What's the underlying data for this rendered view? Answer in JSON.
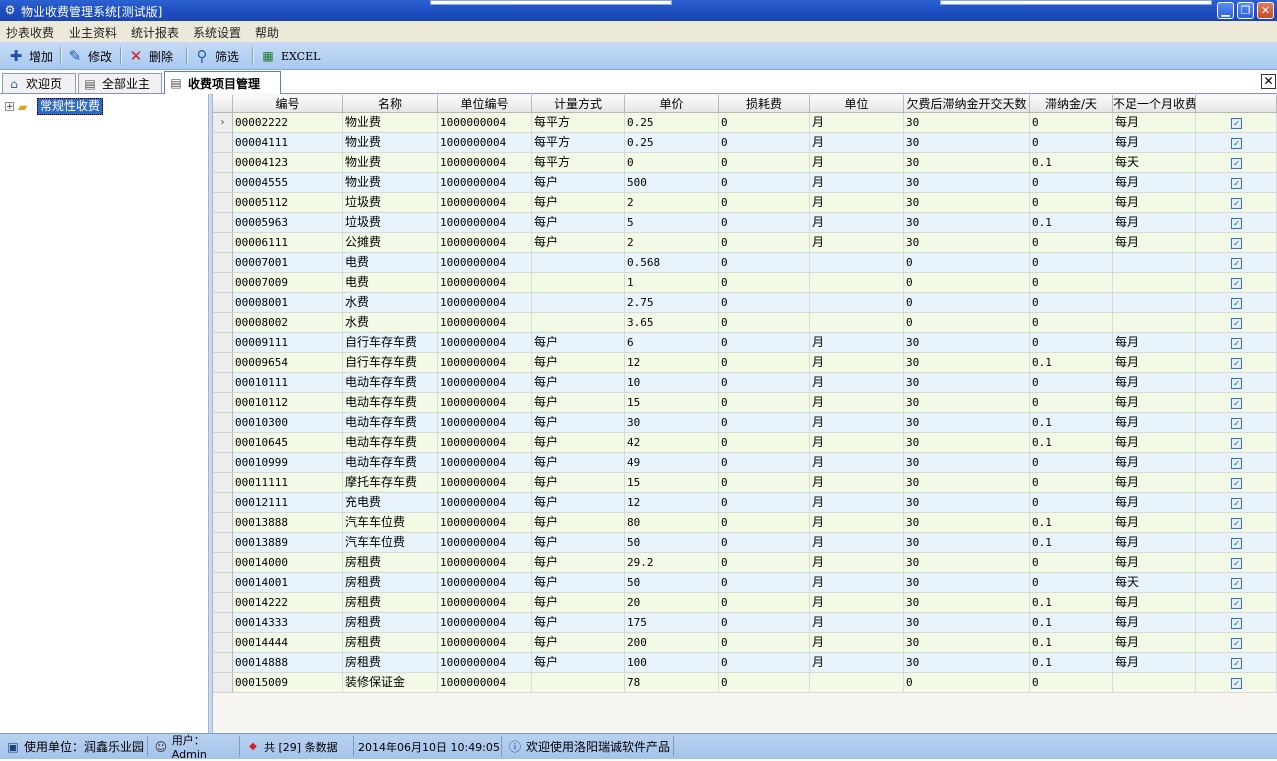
{
  "window": {
    "title": "物业收费管理系统[测试版]",
    "minimize": "▁",
    "restore": "❐",
    "close": "✕"
  },
  "menu": [
    "抄表收费",
    "业主资料",
    "统计报表",
    "系统设置",
    "帮助"
  ],
  "toolbar": {
    "add": "增加",
    "edit": "修改",
    "delete": "删除",
    "filter": "筛选",
    "excel": "EXCEL"
  },
  "tabs": [
    "欢迎页",
    "全部业主",
    "收费项目管理"
  ],
  "tab_close": "✕",
  "tree": {
    "expander": "+",
    "root": "常规性收费"
  },
  "grid": {
    "columns": [
      "编号",
      "名称",
      "单位编号",
      "计量方式",
      "单价",
      "损耗费",
      "单位",
      "欠费后滞纳金开交天数",
      "滞纳金/天",
      "不足一个月收费",
      ""
    ],
    "current_row_marker": "›",
    "check_mark": "✓",
    "rows": [
      [
        "00002222",
        "物业费",
        "1000000004",
        "每平方",
        "0.25",
        "0",
        "月",
        "30",
        "0",
        "每月"
      ],
      [
        "00004111",
        "物业费",
        "1000000004",
        "每平方",
        "0.25",
        "0",
        "月",
        "30",
        "0",
        "每月"
      ],
      [
        "00004123",
        "物业费",
        "1000000004",
        "每平方",
        "0",
        "0",
        "月",
        "30",
        "0.1",
        "每天"
      ],
      [
        "00004555",
        "物业费",
        "1000000004",
        "每户",
        "500",
        "0",
        "月",
        "30",
        "0",
        "每月"
      ],
      [
        "00005112",
        "垃圾费",
        "1000000004",
        "每户",
        "2",
        "0",
        "月",
        "30",
        "0",
        "每月"
      ],
      [
        "00005963",
        "垃圾费",
        "1000000004",
        "每户",
        "5",
        "0",
        "月",
        "30",
        "0.1",
        "每月"
      ],
      [
        "00006111",
        "公摊费",
        "1000000004",
        "每户",
        "2",
        "0",
        "月",
        "30",
        "0",
        "每月"
      ],
      [
        "00007001",
        "电费",
        "1000000004",
        "",
        "0.568",
        "0",
        "",
        "0",
        "0",
        ""
      ],
      [
        "00007009",
        "电费",
        "1000000004",
        "",
        "1",
        "0",
        "",
        "0",
        "0",
        ""
      ],
      [
        "00008001",
        "水费",
        "1000000004",
        "",
        "2.75",
        "0",
        "",
        "0",
        "0",
        ""
      ],
      [
        "00008002",
        "水费",
        "1000000004",
        "",
        "3.65",
        "0",
        "",
        "0",
        "0",
        ""
      ],
      [
        "00009111",
        "自行车存车费",
        "1000000004",
        "每户",
        "6",
        "0",
        "月",
        "30",
        "0",
        "每月"
      ],
      [
        "00009654",
        "自行车存车费",
        "1000000004",
        "每户",
        "12",
        "0",
        "月",
        "30",
        "0.1",
        "每月"
      ],
      [
        "00010111",
        "电动车存车费",
        "1000000004",
        "每户",
        "10",
        "0",
        "月",
        "30",
        "0",
        "每月"
      ],
      [
        "00010112",
        "电动车存车费",
        "1000000004",
        "每户",
        "15",
        "0",
        "月",
        "30",
        "0",
        "每月"
      ],
      [
        "00010300",
        "电动车存车费",
        "1000000004",
        "每户",
        "30",
        "0",
        "月",
        "30",
        "0.1",
        "每月"
      ],
      [
        "00010645",
        "电动车存车费",
        "1000000004",
        "每户",
        "42",
        "0",
        "月",
        "30",
        "0.1",
        "每月"
      ],
      [
        "00010999",
        "电动车存车费",
        "1000000004",
        "每户",
        "49",
        "0",
        "月",
        "30",
        "0",
        "每月"
      ],
      [
        "00011111",
        "摩托车存车费",
        "1000000004",
        "每户",
        "15",
        "0",
        "月",
        "30",
        "0",
        "每月"
      ],
      [
        "00012111",
        "充电费",
        "1000000004",
        "每户",
        "12",
        "0",
        "月",
        "30",
        "0",
        "每月"
      ],
      [
        "00013888",
        "汽车车位费",
        "1000000004",
        "每户",
        "80",
        "0",
        "月",
        "30",
        "0.1",
        "每月"
      ],
      [
        "00013889",
        "汽车车位费",
        "1000000004",
        "每户",
        "50",
        "0",
        "月",
        "30",
        "0.1",
        "每月"
      ],
      [
        "00014000",
        "房租费",
        "1000000004",
        "每户",
        "29.2",
        "0",
        "月",
        "30",
        "0",
        "每月"
      ],
      [
        "00014001",
        "房租费",
        "1000000004",
        "每户",
        "50",
        "0",
        "月",
        "30",
        "0",
        "每天"
      ],
      [
        "00014222",
        "房租费",
        "1000000004",
        "每户",
        "20",
        "0",
        "月",
        "30",
        "0.1",
        "每月"
      ],
      [
        "00014333",
        "房租费",
        "1000000004",
        "每户",
        "175",
        "0",
        "月",
        "30",
        "0.1",
        "每月"
      ],
      [
        "00014444",
        "房租费",
        "1000000004",
        "每户",
        "200",
        "0",
        "月",
        "30",
        "0.1",
        "每月"
      ],
      [
        "00014888",
        "房租费",
        "1000000004",
        "每户",
        "100",
        "0",
        "月",
        "30",
        "0.1",
        "每月"
      ],
      [
        "00015009",
        "装修保证金",
        "1000000004",
        "",
        "78",
        "0",
        "",
        "0",
        "0",
        ""
      ]
    ]
  },
  "status": {
    "unit": "使用单位：润鑫乐业园",
    "user": "用户：Admin",
    "count": "共 [29] 条数据",
    "datetime": "2014年06月10日 10:49:05",
    "welcome": "欢迎使用洛阳瑞诚软件产品"
  },
  "colors": {
    "row_odd": "#f2f9e4",
    "row_even": "#e8f3fb",
    "accent": "#316ac5"
  }
}
